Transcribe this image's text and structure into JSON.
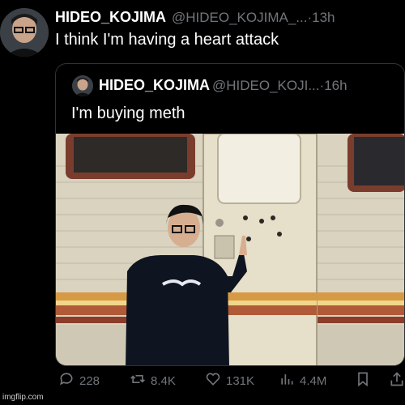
{
  "tweet": {
    "author_name": "HIDEO_KOJIMA",
    "author_handle": "@HIDEO_KOJIMA_...",
    "time": "13h",
    "text": "I think I'm having a heart attack"
  },
  "quoted_tweet": {
    "author_name": "HIDEO_KOJIMA",
    "author_handle": "@HIDEO_KOJI...",
    "time": "16h",
    "text": "I'm buying meth",
    "photo_description": "man in black sweatshirt pointing at bullet holes on an RV door"
  },
  "actions": {
    "replies": "228",
    "reposts": "8.4K",
    "likes": "131K",
    "views": "4.4M"
  },
  "watermark": "imgflip.com",
  "colors": {
    "background": "#000000",
    "text": "#e7e9ea",
    "muted": "#71767b",
    "border": "#2f3336"
  },
  "icons": [
    "reply-icon",
    "repost-icon",
    "like-icon",
    "views-icon",
    "bookmark-icon",
    "share-icon"
  ]
}
